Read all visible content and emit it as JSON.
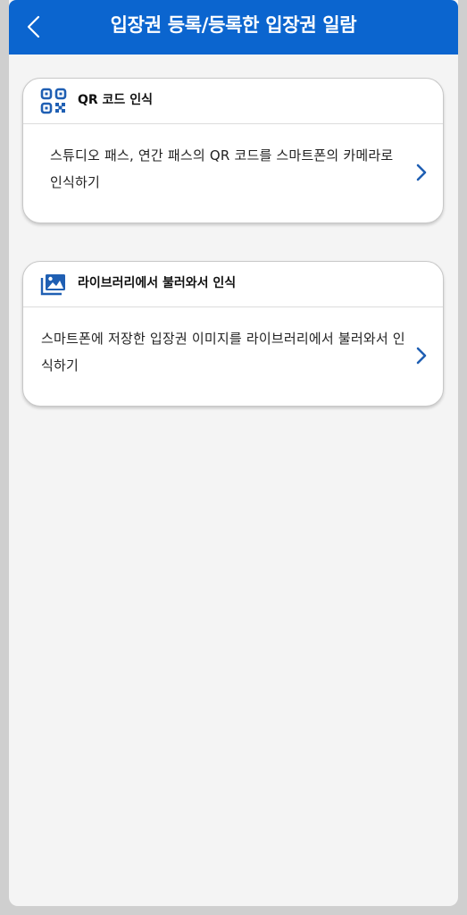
{
  "header": {
    "title": "입장권 등록/등록한 입장권 일람",
    "back_icon": "chevron-left-icon",
    "background": "#0b65cf"
  },
  "cards": [
    {
      "icon": "qr-code-icon",
      "title": "QR 코드 인식",
      "description": "스튜디오 패스, 연간 패스의 QR 코드를 스마트폰의 카메라로 인식하기",
      "action_icon": "chevron-right-icon"
    },
    {
      "icon": "image-gallery-icon",
      "title": "라이브러리에서 불러와서 인식",
      "description": "스마트폰에 저장한 입장권 이미지를 라이브러리에서 불러와서 인식하기",
      "action_icon": "chevron-right-icon"
    }
  ],
  "colors": {
    "accent": "#0b65cf",
    "icon": "#1f5fb3"
  }
}
